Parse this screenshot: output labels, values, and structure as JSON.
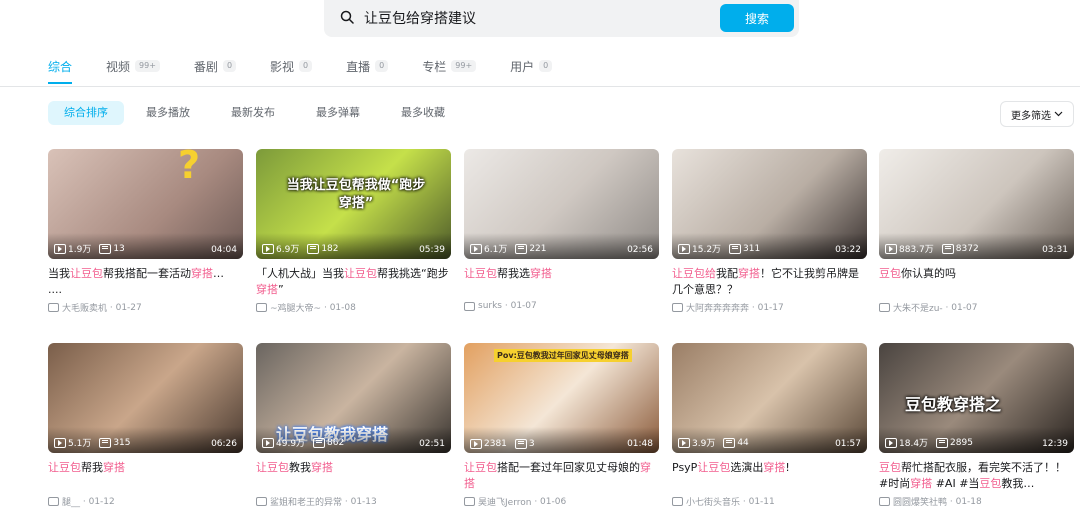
{
  "search": {
    "value": "让豆包给穿搭建议",
    "button": "搜索"
  },
  "tabs": [
    {
      "label": "综合",
      "count": ""
    },
    {
      "label": "视频",
      "count": "99+"
    },
    {
      "label": "番剧",
      "count": "0"
    },
    {
      "label": "影视",
      "count": "0"
    },
    {
      "label": "直播",
      "count": "0"
    },
    {
      "label": "专栏",
      "count": "99+"
    },
    {
      "label": "用户",
      "count": "0"
    }
  ],
  "sorts": [
    "综合排序",
    "最多播放",
    "最新发布",
    "最多弹幕",
    "最多收藏"
  ],
  "more_filter": "更多筛选",
  "colors": {
    "accent": "#00aeec",
    "highlight": "#f25d8e"
  },
  "videos": [
    {
      "views": "1.9万",
      "danmaku": "13",
      "duration": "04:04",
      "title_parts": [
        "当我",
        "让豆包",
        "帮我搭配一套活动",
        "穿搭",
        "…",
        "",
        "\n....",
        ""
      ],
      "author": "大毛贩卖机",
      "date": "01-27",
      "overlay": "?"
    },
    {
      "views": "6.9万",
      "danmaku": "182",
      "duration": "05:39",
      "title_parts": [
        "「人机大战」当我",
        "让豆包",
        "帮我挑选“跑步",
        "穿搭",
        "”",
        ""
      ],
      "author": "~鸡腿大帝~",
      "date": "01-08",
      "overlay": "当我让豆包帮我做“跑步穿搭”"
    },
    {
      "views": "6.1万",
      "danmaku": "221",
      "duration": "02:56",
      "title_parts": [
        "",
        "让豆包",
        "帮我选",
        "穿搭",
        "",
        ""
      ],
      "author": "surks",
      "date": "01-07",
      "overlay": ""
    },
    {
      "views": "15.2万",
      "danmaku": "311",
      "duration": "03:22",
      "title_parts": [
        "",
        "让豆包给",
        "我配",
        "穿搭",
        "！它不让我剪吊牌是几个意思？？",
        ""
      ],
      "author": "大阿奔奔奔奔奔",
      "date": "01-17",
      "overlay": ""
    },
    {
      "views": "883.7万",
      "danmaku": "8372",
      "duration": "03:31",
      "title_parts": [
        "",
        "豆包",
        "你认真的吗",
        "",
        "",
        ""
      ],
      "author": "大朱不是zu-",
      "date": "01-07",
      "overlay": ""
    },
    {
      "views": "5.1万",
      "danmaku": "315",
      "duration": "06:26",
      "title_parts": [
        "",
        "让豆包",
        "帮我",
        "穿搭",
        "",
        ""
      ],
      "author": "腿__",
      "date": "01-12",
      "overlay": ""
    },
    {
      "views": "49.9万",
      "danmaku": "862",
      "duration": "02:51",
      "title_parts": [
        "",
        "让豆包",
        "教我",
        "穿搭",
        "",
        ""
      ],
      "author": "鲨姐和老王的异常",
      "date": "01-13",
      "overlay": "让豆包教我穿搭"
    },
    {
      "views": "2381",
      "danmaku": "3",
      "duration": "01:48",
      "title_parts": [
        "",
        "让豆包",
        "搭配一套过年回家见丈母娘的",
        "穿搭",
        "",
        ""
      ],
      "author": "昊迪飞Jerron",
      "date": "01-06",
      "overlay": "Pov:豆包教我过年回家见丈母娘穿搭"
    },
    {
      "views": "3.9万",
      "danmaku": "44",
      "duration": "01:57",
      "title_parts": [
        "PsyP",
        "让豆包",
        "选演出",
        "穿搭",
        "!",
        ""
      ],
      "author": "小七街头音乐",
      "date": "01-11",
      "overlay": ""
    },
    {
      "views": "18.4万",
      "danmaku": "2895",
      "duration": "12:39",
      "title_parts": [
        "",
        "豆包",
        "帮忙搭配衣服，看完笑不活了！！ #时尚",
        "穿搭",
        " #AI #当",
        "豆包",
        "教我…"
      ],
      "author": "圆圆爆笑社鸭",
      "date": "01-18",
      "overlay": "豆包教穿搭之"
    }
  ]
}
